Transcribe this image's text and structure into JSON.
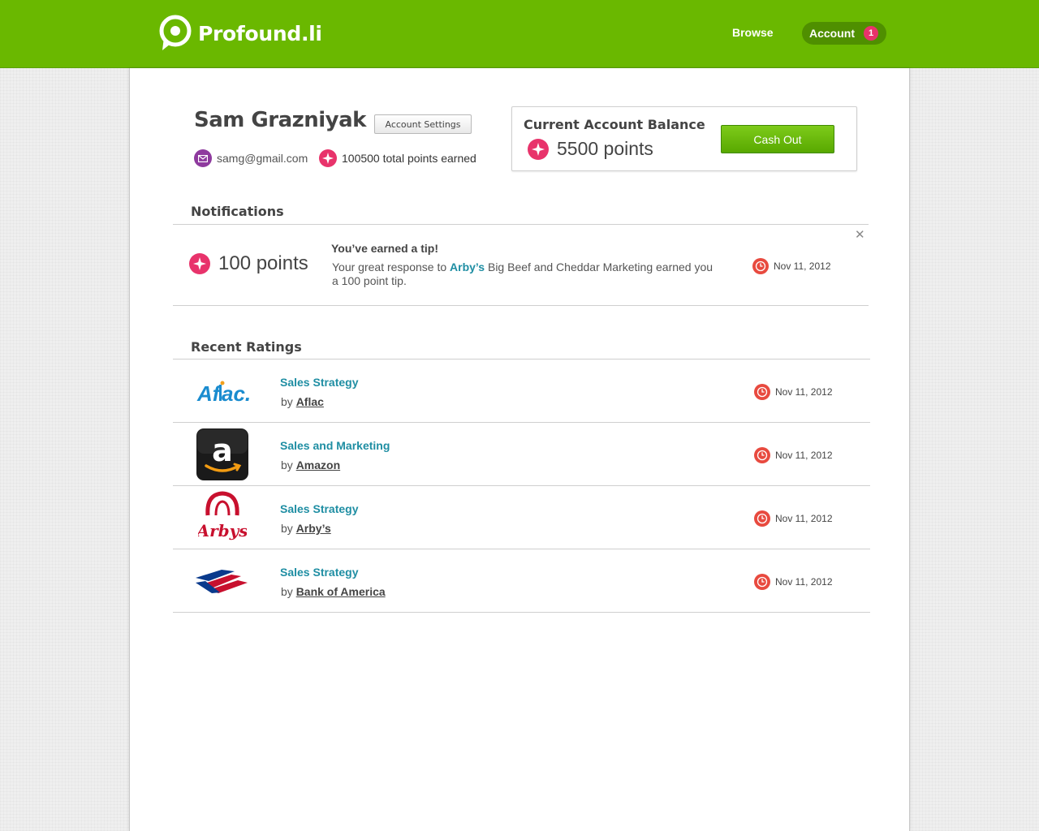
{
  "header": {
    "brand": "Profound.li",
    "nav": {
      "browse": "Browse",
      "account": "Account",
      "account_badge": "1"
    },
    "colors": {
      "brand_green": "#6ab800",
      "badge": "#e8336b"
    }
  },
  "profile": {
    "name": "Sam Grazniyak",
    "settings_label": "Account Settings",
    "email": "samg@gmail.com",
    "total_points": "100500 total points earned"
  },
  "balance": {
    "title": "Current Account Balance",
    "points": "5500 points",
    "cashout_label": "Cash Out"
  },
  "notifications": {
    "title": "Notifications",
    "items": [
      {
        "points": "100 points",
        "heading": "You’ve earned a tip!",
        "body_prefix": "Your great response to ",
        "body_link": "Arby’s",
        "body_suffix": " Big Beef and Cheddar Marketing earned you a 100 point tip.",
        "date": "Nov 11, 2012"
      }
    ]
  },
  "ratings": {
    "title": "Recent Ratings",
    "by_label": "by",
    "items": [
      {
        "title": "Sales Strategy",
        "company": "Aflac",
        "date": "Nov 11, 2012",
        "logo": "aflac-logo"
      },
      {
        "title": "Sales and Marketing",
        "company": "Amazon",
        "date": "Nov 11, 2012",
        "logo": "amazon-logo"
      },
      {
        "title": "Sales Strategy",
        "company": "Arby’s",
        "date": "Nov 11, 2012",
        "logo": "arbys-logo"
      },
      {
        "title": "Sales Strategy",
        "company": "Bank of America",
        "date": "Nov 11, 2012",
        "logo": "bank-of-america-logo"
      }
    ]
  },
  "icons": {
    "logo": "profoundli-logo-icon",
    "mail": "mail-icon",
    "points": "points-star-icon",
    "clock": "clock-icon",
    "close": "close-icon"
  }
}
